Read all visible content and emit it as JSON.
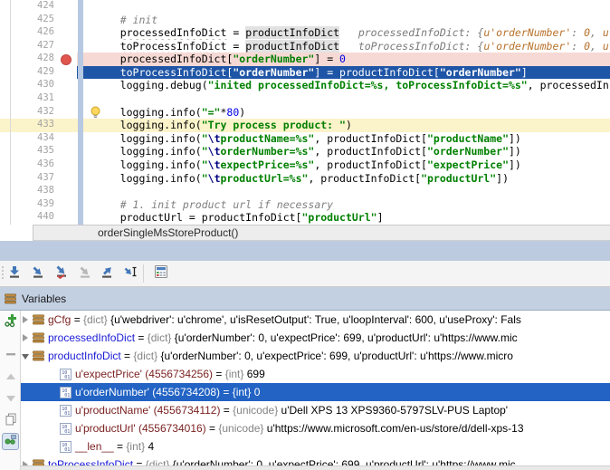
{
  "editor": {
    "context_function": "orderSingleMsStoreProduct()",
    "lines": [
      {
        "n": "424",
        "segs": []
      },
      {
        "n": "425",
        "segs": [
          [
            "cm",
            "    # init"
          ]
        ]
      },
      {
        "n": "426",
        "segs": [
          [
            "pl",
            "    "
          ],
          [
            "sq",
            "processedInfoDict"
          ],
          [
            "pl",
            " = "
          ],
          [
            "hl",
            "productInfoDict"
          ],
          [
            "pl",
            "   "
          ],
          [
            "hn",
            "processedInfoDict: {"
          ],
          [
            "ha",
            "u'orderNumber'"
          ],
          [
            "hn",
            ": "
          ],
          [
            "ha",
            "0"
          ],
          [
            "hn",
            ", "
          ],
          [
            "ha",
            "u'"
          ]
        ]
      },
      {
        "n": "427",
        "segs": [
          [
            "pl",
            "    "
          ],
          [
            "sq",
            "toProcessInfoDict"
          ],
          [
            "pl",
            " = "
          ],
          [
            "hl",
            "productInfoDict"
          ],
          [
            "pl",
            "   "
          ],
          [
            "hn",
            "toProcessInfoDict: {"
          ],
          [
            "ha",
            "u'orderNumber'"
          ],
          [
            "hn",
            ": "
          ],
          [
            "ha",
            "0"
          ],
          [
            "hn",
            ", "
          ],
          [
            "ha",
            "u'"
          ]
        ]
      },
      {
        "n": "428",
        "bg": "bp",
        "bp": true,
        "segs": [
          [
            "pl",
            "    processedInfoDict["
          ],
          [
            "st",
            "\"orderNumber\""
          ],
          [
            "pl",
            "] = "
          ],
          [
            "nu",
            "0"
          ]
        ]
      },
      {
        "n": "429",
        "bg": "exec",
        "segs": [
          [
            "pl",
            "    toProcessInfoDict["
          ],
          [
            "st",
            "\"orderNumber\""
          ],
          [
            "pl",
            "] = productInfoDict["
          ],
          [
            "st",
            "\"orderNumber\""
          ],
          [
            "pl",
            "]"
          ]
        ]
      },
      {
        "n": "430",
        "segs": [
          [
            "pl",
            "    logging.debug("
          ],
          [
            "st",
            "\"inited processedInfoDict=%s, toProcessInfoDict=%s\""
          ],
          [
            "pl",
            ", processedIn"
          ]
        ]
      },
      {
        "n": "431",
        "segs": []
      },
      {
        "n": "432",
        "bulb": true,
        "segs": [
          [
            "pl",
            "    logging.info("
          ],
          [
            "st",
            "\"=\""
          ],
          [
            "pl",
            "*"
          ],
          [
            "nu",
            "80"
          ],
          [
            "pl",
            ")"
          ]
        ]
      },
      {
        "n": "433",
        "bg": "caret",
        "segs": [
          [
            "pl",
            "    logging.info("
          ],
          [
            "st",
            "\"Try process product: \""
          ],
          [
            "pl",
            ")"
          ]
        ]
      },
      {
        "n": "434",
        "segs": [
          [
            "pl",
            "    logging.info("
          ],
          [
            "st",
            "\""
          ],
          [
            "es",
            "\\t"
          ],
          [
            "st",
            "productName=%s\""
          ],
          [
            "pl",
            ", productInfoDict["
          ],
          [
            "st",
            "\"productName\""
          ],
          [
            "pl",
            "])"
          ]
        ]
      },
      {
        "n": "435",
        "segs": [
          [
            "pl",
            "    logging.info("
          ],
          [
            "st",
            "\""
          ],
          [
            "es",
            "\\t"
          ],
          [
            "st",
            "orderNumber=%s\""
          ],
          [
            "pl",
            ", productInfoDict["
          ],
          [
            "st",
            "\"orderNumber\""
          ],
          [
            "pl",
            "])"
          ]
        ]
      },
      {
        "n": "436",
        "segs": [
          [
            "pl",
            "    logging.info("
          ],
          [
            "st",
            "\""
          ],
          [
            "es",
            "\\t"
          ],
          [
            "st",
            "expectPrice=%s\""
          ],
          [
            "pl",
            ", productInfoDict["
          ],
          [
            "st",
            "\"expectPrice\""
          ],
          [
            "pl",
            "])"
          ]
        ]
      },
      {
        "n": "437",
        "segs": [
          [
            "pl",
            "    logging.info("
          ],
          [
            "st",
            "\""
          ],
          [
            "es",
            "\\t"
          ],
          [
            "st",
            "productUrl=%s\""
          ],
          [
            "pl",
            ", productInfoDict["
          ],
          [
            "st",
            "\"productUrl\""
          ],
          [
            "pl",
            "])"
          ]
        ]
      },
      {
        "n": "438",
        "segs": []
      },
      {
        "n": "439",
        "segs": [
          [
            "cm",
            "    # 1. init product url if necessary"
          ]
        ]
      },
      {
        "n": "440",
        "segs": [
          [
            "pl",
            "    productUrl = productInfoDict["
          ],
          [
            "st",
            "\"productUrl\""
          ],
          [
            "pl",
            "]"
          ]
        ]
      }
    ]
  },
  "step_toolbar": {
    "icons": [
      {
        "name": "show-execution-point"
      },
      {
        "name": "step-over"
      },
      {
        "name": "step-into-my-code"
      },
      {
        "name": "force-step-into",
        "disabled": true
      },
      {
        "name": "step-out"
      },
      {
        "name": "run-to-cursor",
        "sep_after": true
      },
      {
        "name": "evaluate-expression"
      }
    ]
  },
  "variables_panel": {
    "title": "Variables",
    "side_toolbar": [
      {
        "name": "add-watch"
      },
      {
        "name": "remove-watch",
        "disabled": true
      },
      {
        "name": "move-up",
        "disabled": true
      },
      {
        "name": "move-down",
        "disabled": true
      },
      {
        "name": "duplicate-watch"
      },
      {
        "name": "show-watches",
        "active": true
      }
    ],
    "rows": [
      {
        "lvl": 0,
        "exp": "c",
        "icon": "dict",
        "segs": [
          [
            "nr",
            "gCfg"
          ],
          [
            "pl",
            " = "
          ],
          [
            "ty",
            "{dict}"
          ],
          [
            "pl",
            " {u'webdriver': u'chrome', u'isResetOutput': True, u'loopInterval': 600, u'useProxy': Fals"
          ]
        ]
      },
      {
        "lvl": 0,
        "exp": "c",
        "icon": "dict",
        "segs": [
          [
            "nb",
            "processedInfoDict"
          ],
          [
            "pl",
            " = "
          ],
          [
            "ty",
            "{dict}"
          ],
          [
            "pl",
            " {u'orderNumber': 0, u'expectPrice': 699, u'productUrl': u'https://www.mic"
          ]
        ]
      },
      {
        "lvl": 0,
        "exp": "e",
        "icon": "dict",
        "segs": [
          [
            "nb",
            "productInfoDict"
          ],
          [
            "pl",
            " = "
          ],
          [
            "ty",
            "{dict}"
          ],
          [
            "pl",
            " {u'orderNumber': 0, u'expectPrice': 699, u'productUrl': u'https://www.micro"
          ]
        ]
      },
      {
        "lvl": 1,
        "icon": "prim",
        "segs": [
          [
            "nr",
            "u'expectPrice' (4556734256)"
          ],
          [
            "pl",
            " = "
          ],
          [
            "ty",
            "{int}"
          ],
          [
            "pl",
            " 699"
          ]
        ]
      },
      {
        "lvl": 1,
        "icon": "prim",
        "sel": true,
        "segs": [
          [
            "nr",
            "u'orderNumber' (4556734208)"
          ],
          [
            "pl",
            " = "
          ],
          [
            "ty",
            "{int}"
          ],
          [
            "pl",
            " 0"
          ]
        ]
      },
      {
        "lvl": 1,
        "icon": "prim",
        "segs": [
          [
            "nr",
            "u'productName' (4556734112)"
          ],
          [
            "pl",
            " = "
          ],
          [
            "ty",
            "{unicode}"
          ],
          [
            "pl",
            " u'Dell XPS 13 XPS9360-5797SLV-PUS Laptop'"
          ]
        ]
      },
      {
        "lvl": 1,
        "icon": "prim",
        "segs": [
          [
            "nr",
            "u'productUrl' (4556734016)"
          ],
          [
            "pl",
            " = "
          ],
          [
            "ty",
            "{unicode}"
          ],
          [
            "pl",
            " u'https://www.microsoft.com/en-us/store/d/dell-xps-13"
          ]
        ]
      },
      {
        "lvl": 1,
        "icon": "prim",
        "segs": [
          [
            "nr",
            "__len__"
          ],
          [
            "pl",
            " = "
          ],
          [
            "ty",
            "{int}"
          ],
          [
            "pl",
            " 4"
          ]
        ]
      },
      {
        "lvl": 0,
        "exp": "c",
        "icon": "dict",
        "segs": [
          [
            "nb",
            "toProcessInfoDict"
          ],
          [
            "pl",
            " = "
          ],
          [
            "ty",
            "{dict}"
          ],
          [
            "pl",
            " {u'orderNumber': 0, u'expectPrice': 699, u'productUrl': u'https://www.mic"
          ]
        ]
      }
    ]
  },
  "colors": {
    "selection_bg": "#2263c4",
    "exec_line_bg": "#1f55a6",
    "breakpoint_line_bg": "#f6d9d4",
    "caret_line_bg": "#fbf3ca",
    "breakpoint_dot": "#e0564e",
    "vcs_stripe": "#b7c9e2",
    "string_green": "#008000",
    "number_blue": "#0000e6",
    "comment_gray": "#808080",
    "name_red": "#7a1f1f",
    "name_blue": "#1a1ad6",
    "type_gray": "#848484",
    "hint_gray": "#7a7a7a",
    "hint_orange": "#b8722b",
    "header_bg": "#c3d0e2",
    "band_bg": "#bccbe0"
  }
}
